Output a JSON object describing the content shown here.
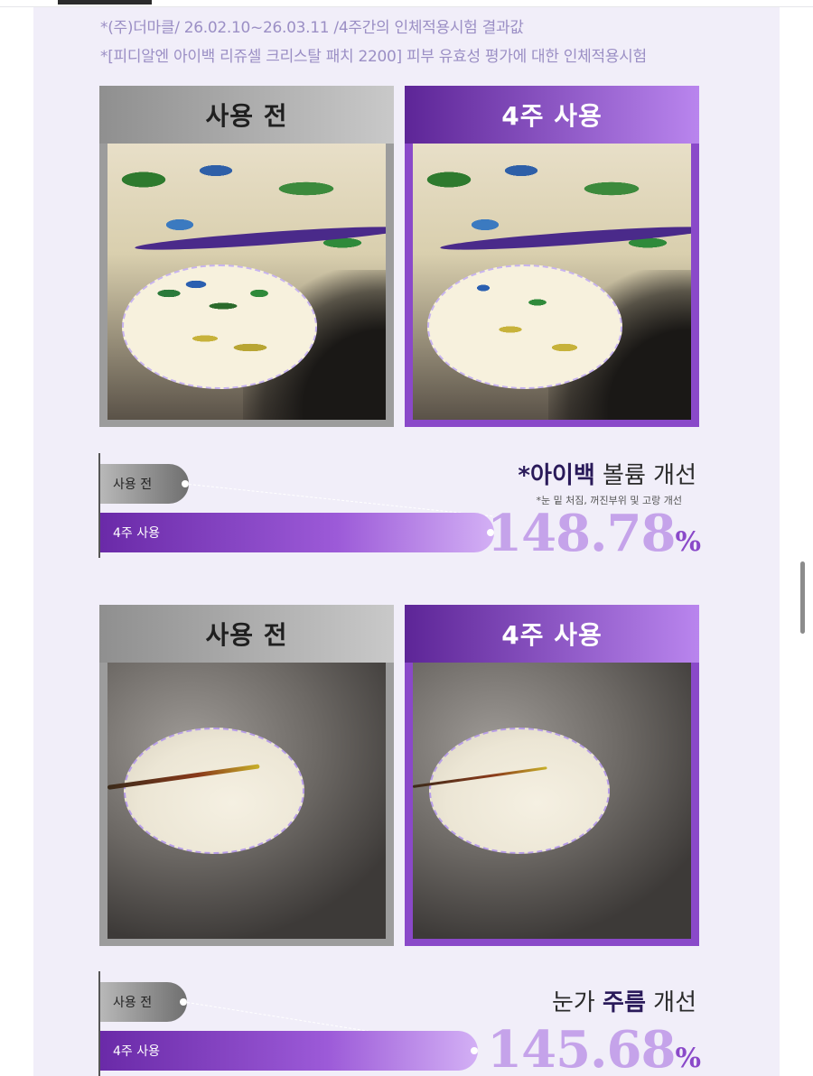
{
  "notes": {
    "line1": "*(주)더마클/ 26.02.10~26.03.11 /4주간의 인체적용시험 결과값",
    "line2": "*[피디알엔 아이백 리쥬셀 크리스탈 패치 2200] 피부 유효성 평가에 대한 인체적용시험"
  },
  "comparisons": [
    {
      "before_label": "사용 전",
      "after_label": "4주 사용",
      "stat": {
        "bar_before_label": "사용 전",
        "bar_after_label": "4주 사용",
        "title_highlight": "*아이백",
        "title_rest": " 볼륨 개선",
        "subtitle": "*눈 밑 처짐, 꺼진부위 및 고랑 개선",
        "value": "148.78",
        "unit": "%"
      }
    },
    {
      "before_label": "사용 전",
      "after_label": "4주 사용",
      "stat": {
        "bar_before_label": "사용 전",
        "bar_after_label": "4주 사용",
        "title_prefix": "눈가 ",
        "title_highlight": "주름",
        "title_rest": " 개선",
        "value": "145.68",
        "unit": "%"
      }
    }
  ],
  "colors": {
    "accent": "#8a49c9",
    "value": "#c5a3ea",
    "background": "#f1eef9"
  }
}
